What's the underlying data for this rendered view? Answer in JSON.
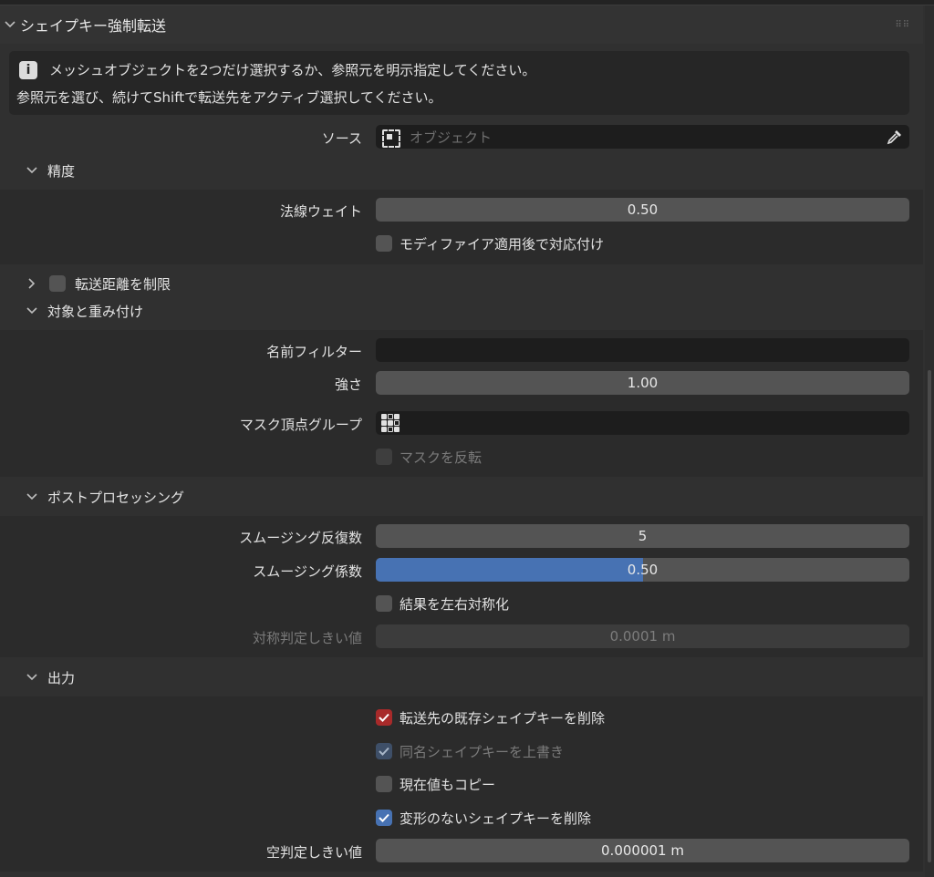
{
  "panel": {
    "title": "シェイプキー強制転送",
    "info_line1": "メッシュオブジェクトを2つだけ選択するか、参照元を明示指定してください。",
    "info_line2": "参照元を選び、続けてShiftで転送先をアクティブ選択してください。",
    "source_label": "ソース",
    "source_placeholder": "オブジェクト"
  },
  "precision": {
    "title": "精度",
    "normal_weight_label": "法線ウェイト",
    "normal_weight_value": "0.50",
    "modifier_label": "モディファイア適用後で対応付け",
    "modifier_checked": false
  },
  "limit_distance": {
    "title": "転送距離を制限",
    "checked": false,
    "expanded": false
  },
  "target": {
    "title": "対象と重み付け",
    "name_filter_label": "名前フィルター",
    "name_filter_value": "",
    "strength_label": "強さ",
    "strength_value": "1.00",
    "mask_group_label": "マスク頂点グループ",
    "mask_group_value": "",
    "invert_mask_label": "マスクを反転",
    "invert_mask_checked": false
  },
  "post": {
    "title": "ポストプロセッシング",
    "smooth_iter_label": "スムージング反復数",
    "smooth_iter_value": "5",
    "smooth_factor_label": "スムージング係数",
    "smooth_factor_value": "0.50",
    "smooth_factor_fraction": 0.5,
    "symmetrize_label": "結果を左右対称化",
    "symmetrize_checked": false,
    "sym_threshold_label": "対称判定しきい値",
    "sym_threshold_value": "0.0001 m"
  },
  "output": {
    "title": "出力",
    "delete_existing_label": "転送先の既存シェイプキーを削除",
    "delete_existing_checked": true,
    "overwrite_label": "同名シェイプキーを上書き",
    "overwrite_checked": true,
    "copy_current_label": "現在値もコピー",
    "copy_current_checked": false,
    "delete_empty_label": "変形のないシェイプキーを削除",
    "delete_empty_checked": true,
    "empty_threshold_label": "空判定しきい値",
    "empty_threshold_value": "0.000001 m"
  },
  "icons": {
    "header_chevron": "chevron-down-icon",
    "info": "info-icon",
    "source_object": "object-icon",
    "eyedropper": "eyedropper-icon",
    "vertex_group": "vertex-group-icon",
    "collapsed": "chevron-right-icon",
    "check": "checkmark-icon"
  },
  "colors": {
    "accent_blue": "#4772b3",
    "check_red": "#a82a2a"
  }
}
